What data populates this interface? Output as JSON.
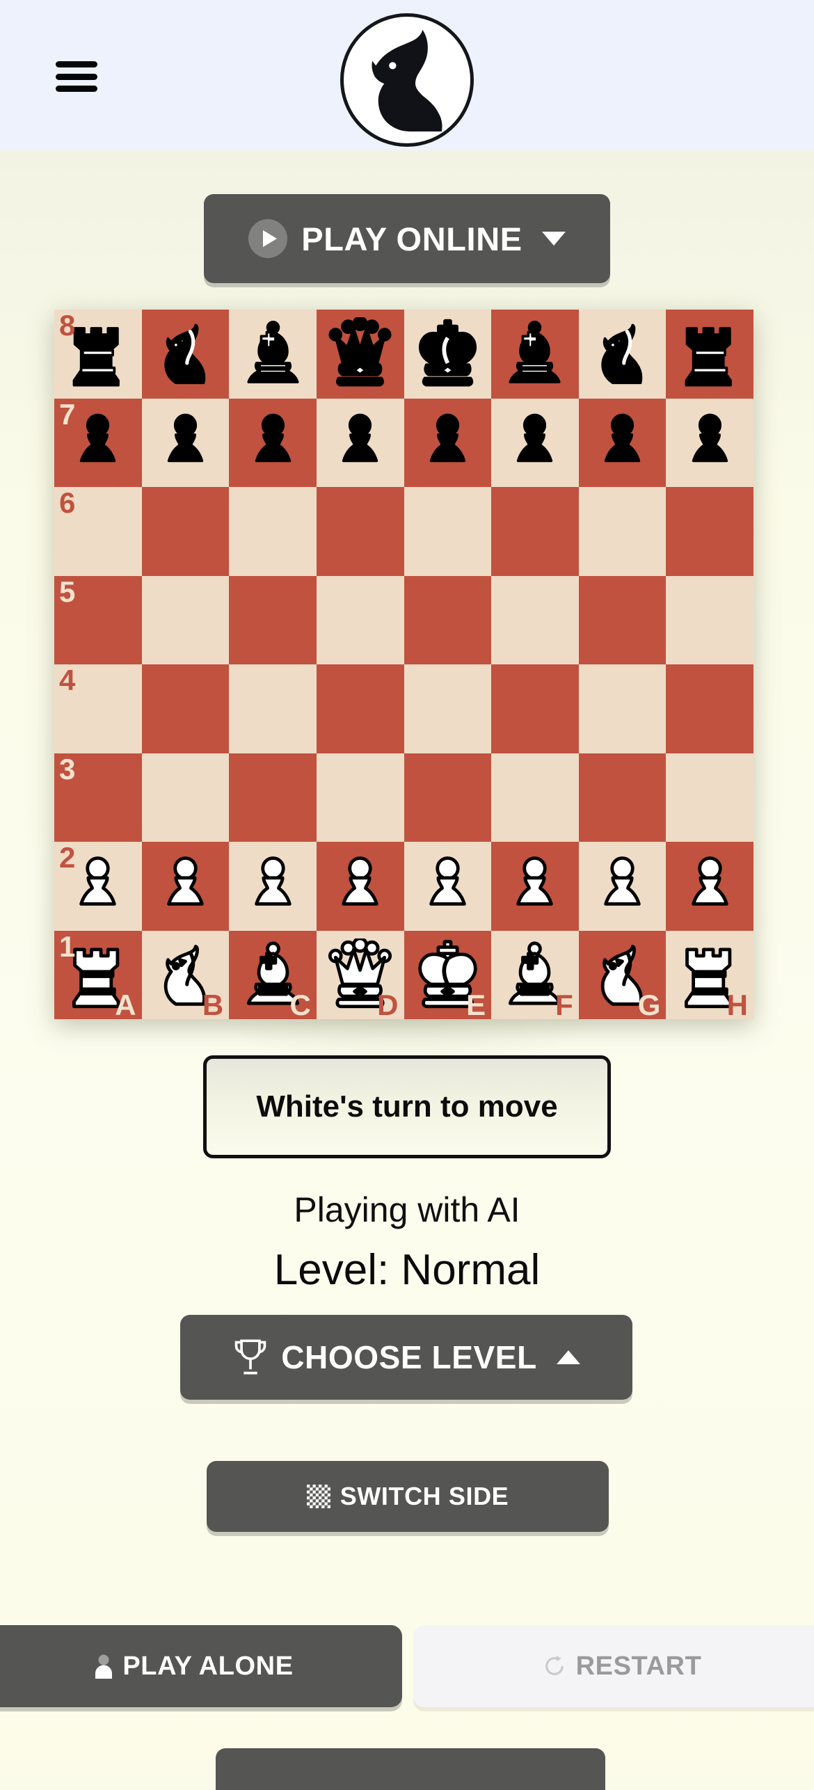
{
  "header": {
    "menu_icon": "hamburger-menu-icon",
    "logo_icon": "knight-horse-head-logo",
    "background_color": "#edf2fc"
  },
  "play_online": {
    "label": "PLAY ONLINE",
    "icon": "play-circle-icon",
    "chevron": "chevron-down-icon"
  },
  "board": {
    "light_color": "#efdcc6",
    "dark_color": "#c0523f",
    "ranks": [
      "8",
      "7",
      "6",
      "5",
      "4",
      "3",
      "2",
      "1"
    ],
    "files": [
      "A",
      "B",
      "C",
      "D",
      "E",
      "F",
      "G",
      "H"
    ],
    "position": [
      [
        "black-rook",
        "black-knight",
        "black-bishop",
        "black-queen",
        "black-king",
        "black-bishop",
        "black-knight",
        "black-rook"
      ],
      [
        "black-pawn",
        "black-pawn",
        "black-pawn",
        "black-pawn",
        "black-pawn",
        "black-pawn",
        "black-pawn",
        "black-pawn"
      ],
      [
        "",
        "",
        "",
        "",
        "",
        "",
        "",
        ""
      ],
      [
        "",
        "",
        "",
        "",
        "",
        "",
        "",
        ""
      ],
      [
        "",
        "",
        "",
        "",
        "",
        "",
        "",
        ""
      ],
      [
        "",
        "",
        "",
        "",
        "",
        "",
        "",
        ""
      ],
      [
        "white-pawn",
        "white-pawn",
        "white-pawn",
        "white-pawn",
        "white-pawn",
        "white-pawn",
        "white-pawn",
        "white-pawn"
      ],
      [
        "white-rook",
        "white-knight",
        "white-bishop",
        "white-queen",
        "white-king",
        "white-bishop",
        "white-knight",
        "white-rook"
      ]
    ]
  },
  "status": {
    "turn_text": "White's turn to move"
  },
  "info": {
    "mode_text": "Playing with AI",
    "level_text": "Level: Normal"
  },
  "choose_level": {
    "label": "CHOOSE LEVEL",
    "icon": "trophy-icon",
    "chevron": "chevron-up-icon"
  },
  "switch_side": {
    "label": "SWITCH SIDE",
    "icon": "checkerboard-icon"
  },
  "bottom_actions": {
    "play_alone_label": "PLAY ALONE",
    "play_alone_icon": "person-icon",
    "restart_label": "RESTART",
    "restart_icon": "refresh-icon"
  }
}
